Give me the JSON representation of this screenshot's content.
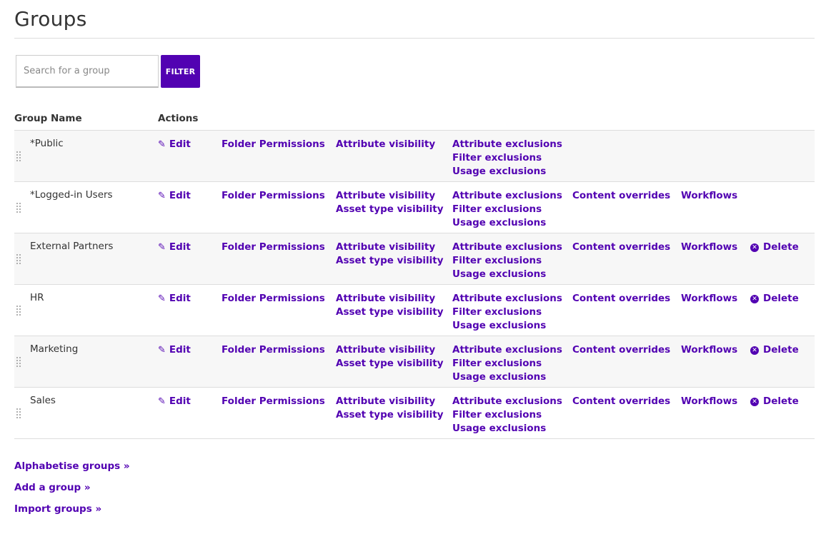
{
  "page": {
    "title": "Groups"
  },
  "search": {
    "placeholder": "Search for a group",
    "value": "",
    "filter_label": "FILTER"
  },
  "columns": {
    "group_name": "Group Name",
    "actions": "Actions"
  },
  "rows": [
    {
      "name": "*Public",
      "edit": "Edit",
      "folder_permissions": "Folder Permissions",
      "visibility": [
        "Attribute visibility"
      ],
      "exclusions": [
        "Attribute exclusions",
        "Filter exclusions",
        "Usage exclusions"
      ],
      "content_overrides": "",
      "workflows": "",
      "delete": ""
    },
    {
      "name": "*Logged-in Users",
      "edit": "Edit",
      "folder_permissions": "Folder Permissions",
      "visibility": [
        "Attribute visibility",
        "Asset type visibility"
      ],
      "exclusions": [
        "Attribute exclusions",
        "Filter exclusions",
        "Usage exclusions"
      ],
      "content_overrides": "Content overrides",
      "workflows": "Workflows",
      "delete": ""
    },
    {
      "name": "External Partners",
      "edit": "Edit",
      "folder_permissions": "Folder Permissions",
      "visibility": [
        "Attribute visibility",
        "Asset type visibility"
      ],
      "exclusions": [
        "Attribute exclusions",
        "Filter exclusions",
        "Usage exclusions"
      ],
      "content_overrides": "Content overrides",
      "workflows": "Workflows",
      "delete": "Delete"
    },
    {
      "name": "HR",
      "edit": "Edit",
      "folder_permissions": "Folder Permissions",
      "visibility": [
        "Attribute visibility",
        "Asset type visibility"
      ],
      "exclusions": [
        "Attribute exclusions",
        "Filter exclusions",
        "Usage exclusions"
      ],
      "content_overrides": "Content overrides",
      "workflows": "Workflows",
      "delete": "Delete"
    },
    {
      "name": "Marketing",
      "edit": "Edit",
      "folder_permissions": "Folder Permissions",
      "visibility": [
        "Attribute visibility",
        "Asset type visibility"
      ],
      "exclusions": [
        "Attribute exclusions",
        "Filter exclusions",
        "Usage exclusions"
      ],
      "content_overrides": "Content overrides",
      "workflows": "Workflows",
      "delete": "Delete"
    },
    {
      "name": "Sales",
      "edit": "Edit",
      "folder_permissions": "Folder Permissions",
      "visibility": [
        "Attribute visibility",
        "Asset type visibility"
      ],
      "exclusions": [
        "Attribute exclusions",
        "Filter exclusions",
        "Usage exclusions"
      ],
      "content_overrides": "Content overrides",
      "workflows": "Workflows",
      "delete": "Delete"
    }
  ],
  "footer": {
    "alphabetise": "Alphabetise groups »",
    "add": "Add a group »",
    "import": "Import groups »"
  },
  "icons": {
    "edit": "pencil-icon",
    "delete": "delete-circle-icon",
    "handle": "drag-handle-icon"
  },
  "colors": {
    "accent": "#5202b2",
    "row_alt": "#f7f7f7",
    "border": "#dddddd",
    "text": "#333333"
  }
}
